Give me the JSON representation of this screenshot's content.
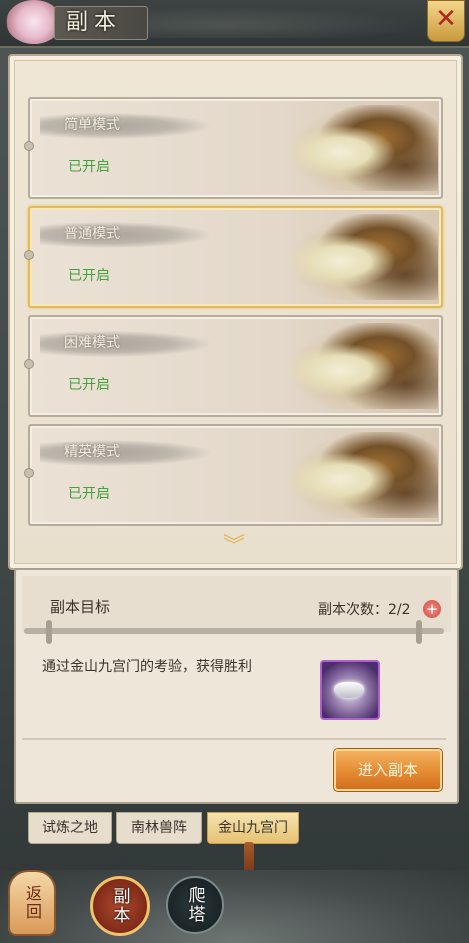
{
  "header": {
    "title": "副本",
    "close_icon": "close-icon"
  },
  "modes": [
    {
      "name": "简单模式",
      "status": "已开启",
      "selected": false
    },
    {
      "name": "普通模式",
      "status": "已开启",
      "selected": true
    },
    {
      "name": "困难模式",
      "status": "已开启",
      "selected": false
    },
    {
      "name": "精英模式",
      "status": "已开启",
      "selected": false
    }
  ],
  "objective": {
    "title": "副本目标",
    "runs_label": "副本次数：2/2",
    "add_runs": "+",
    "description": "通过金山九宫门的考验，获得胜利",
    "reward_icon": "silver-ingot-icon",
    "enter_button": "进入副本"
  },
  "tabs": [
    {
      "label": "试炼之地",
      "active": false
    },
    {
      "label": "南林兽阵",
      "active": false
    },
    {
      "label": "金山九宫门",
      "active": true
    }
  ],
  "bottom_nav": {
    "back": "返回",
    "dungeon": "副本",
    "tower": "爬塔"
  },
  "colors": {
    "status_green": "#45a13e",
    "selected_border": "#e2b95b",
    "enter_orange": "#e58b32"
  }
}
